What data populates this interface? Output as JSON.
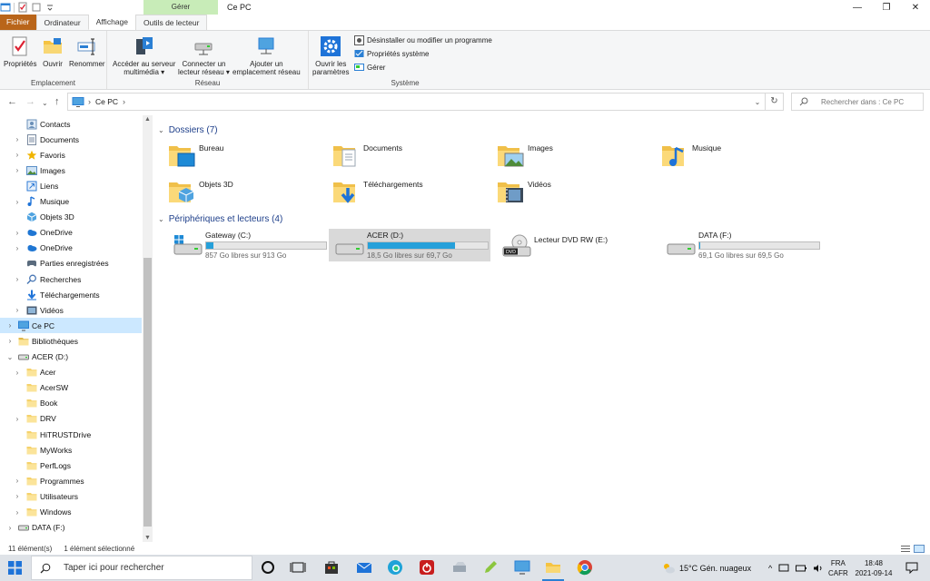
{
  "window": {
    "title": "Ce PC",
    "context_group": "Gérer",
    "controls": {
      "minimize": "—",
      "restore": "❐",
      "close": "✕"
    }
  },
  "tabs": {
    "file": "Fichier",
    "computer": "Ordinateur",
    "view": "Affichage",
    "drive_tools": "Outils de lecteur"
  },
  "ribbon": {
    "emplacement": {
      "label": "Emplacement",
      "properties": "Propriétés",
      "open": "Ouvrir",
      "rename": "Renommer"
    },
    "reseau": {
      "label": "Réseau",
      "media_line1": "Accéder au serveur",
      "media_line2": "multimédia ▾",
      "map_line1": "Connecter un",
      "map_line2": "lecteur réseau ▾",
      "add_line1": "Ajouter un",
      "add_line2": "emplacement réseau"
    },
    "systeme": {
      "label": "Système",
      "settings_line1": "Ouvrir les",
      "settings_line2": "paramètres",
      "uninstall": "Désinstaller ou modifier un programme",
      "sys_props": "Propriétés système",
      "manage": "Gérer"
    }
  },
  "address": {
    "path": "Ce PC",
    "search_placeholder": "Rechercher dans : Ce PC"
  },
  "nav": {
    "items": [
      {
        "label": "Contacts",
        "icon": "contacts-icon",
        "expandable": false,
        "indent": 1,
        "color": "#6a8fb8"
      },
      {
        "label": "Documents",
        "icon": "documents-icon",
        "expandable": true,
        "indent": 1,
        "color": "#7a8aa0"
      },
      {
        "label": "Favoris",
        "icon": "star-icon",
        "expandable": true,
        "indent": 1,
        "color": "#f0b400"
      },
      {
        "label": "Images",
        "icon": "images-icon",
        "expandable": true,
        "indent": 1,
        "color": "#5b8fc7"
      },
      {
        "label": "Liens",
        "icon": "link-icon",
        "expandable": false,
        "indent": 1,
        "color": "#2d7ad6"
      },
      {
        "label": "Musique",
        "icon": "music-icon",
        "expandable": true,
        "indent": 1,
        "color": "#1e73d8"
      },
      {
        "label": "Objets 3D",
        "icon": "objects-3d-icon",
        "expandable": false,
        "indent": 1,
        "color": "#4fa3e0"
      },
      {
        "label": "OneDrive",
        "icon": "onedrive-icon",
        "expandable": true,
        "indent": 1,
        "color": "#1f76d3"
      },
      {
        "label": "OneDrive",
        "icon": "onedrive-icon",
        "expandable": true,
        "indent": 1,
        "color": "#1f76d3"
      },
      {
        "label": "Parties enregistrées",
        "icon": "saved-games-icon",
        "expandable": false,
        "indent": 1,
        "color": "#5a6b7d"
      },
      {
        "label": "Recherches",
        "icon": "search-icon",
        "expandable": true,
        "indent": 1,
        "color": "#4a78b5"
      },
      {
        "label": "Téléchargements",
        "icon": "download-icon",
        "expandable": false,
        "indent": 1,
        "color": "#1e73d8"
      },
      {
        "label": "Vidéos",
        "icon": "videos-icon",
        "expandable": true,
        "indent": 1,
        "color": "#4a5b70"
      },
      {
        "label": "Ce PC",
        "icon": "this-pc-icon",
        "expandable": true,
        "indent": 0,
        "color": "#2a7fd4",
        "selected": true
      },
      {
        "label": "Bibliothèques",
        "icon": "libraries-icon",
        "expandable": true,
        "indent": 0,
        "color": "#e0b94a"
      },
      {
        "label": "ACER (D:)",
        "icon": "drive-icon",
        "expandable": true,
        "expanded": true,
        "indent": 0,
        "color": "#777777"
      },
      {
        "label": "Acer",
        "icon": "folder-icon",
        "expandable": true,
        "indent": 1,
        "color": "#f5d26b"
      },
      {
        "label": "AcerSW",
        "icon": "folder-icon",
        "expandable": false,
        "indent": 1,
        "color": "#f5d26b"
      },
      {
        "label": "Book",
        "icon": "folder-icon",
        "expandable": false,
        "indent": 1,
        "color": "#f5d26b"
      },
      {
        "label": "DRV",
        "icon": "folder-icon",
        "expandable": true,
        "indent": 1,
        "color": "#f5d26b"
      },
      {
        "label": "HiTRUSTDrive",
        "icon": "folder-icon",
        "expandable": false,
        "indent": 1,
        "color": "#f5d26b"
      },
      {
        "label": "MyWorks",
        "icon": "folder-icon",
        "expandable": false,
        "indent": 1,
        "color": "#f5d26b"
      },
      {
        "label": "PerfLogs",
        "icon": "folder-icon",
        "expandable": false,
        "indent": 1,
        "color": "#f5d26b"
      },
      {
        "label": "Programmes",
        "icon": "folder-icon",
        "expandable": true,
        "indent": 1,
        "color": "#f5d26b"
      },
      {
        "label": "Utilisateurs",
        "icon": "folder-icon",
        "expandable": true,
        "indent": 1,
        "color": "#f5d26b"
      },
      {
        "label": "Windows",
        "icon": "folder-icon",
        "expandable": true,
        "indent": 1,
        "color": "#f5d26b"
      },
      {
        "label": "DATA (F:)",
        "icon": "drive-icon",
        "expandable": true,
        "indent": 0,
        "color": "#777777"
      }
    ]
  },
  "content": {
    "folders_header": "Dossiers (7)",
    "folders": [
      {
        "name": "Bureau",
        "icon": "desktop-folder-icon"
      },
      {
        "name": "Documents",
        "icon": "documents-folder-icon"
      },
      {
        "name": "Images",
        "icon": "images-folder-icon"
      },
      {
        "name": "Musique",
        "icon": "music-folder-icon"
      },
      {
        "name": "Objets 3D",
        "icon": "objects-3d-folder-icon"
      },
      {
        "name": "Téléchargements",
        "icon": "downloads-folder-icon"
      },
      {
        "name": "Vidéos",
        "icon": "videos-folder-icon"
      }
    ],
    "devices_header": "Périphériques et lecteurs (4)",
    "drives": [
      {
        "name": "Gateway (C:)",
        "free": "857 Go libres sur 913 Go",
        "used_fraction": 0.06,
        "icon": "windows-drive-icon",
        "selected": false
      },
      {
        "name": "ACER (D:)",
        "free": "18,5 Go libres sur 69,7 Go",
        "used_fraction": 0.73,
        "icon": "drive-icon",
        "selected": true
      },
      {
        "name": "Lecteur DVD RW (E:)",
        "free": "",
        "used_fraction": null,
        "icon": "dvd-drive-icon",
        "selected": false
      },
      {
        "name": "DATA (F:)",
        "free": "69,1 Go libres sur 69,5 Go",
        "used_fraction": 0.006,
        "icon": "drive-icon",
        "selected": false
      }
    ]
  },
  "status": {
    "count": "11 élément(s)",
    "selection": "1 élément sélectionné"
  },
  "taskbar": {
    "search_placeholder": "Taper ici pour rechercher",
    "weather": "15°C  Gén. nuageux",
    "lang_line1": "FRA",
    "lang_line2": "CAFR",
    "time": "18:48",
    "date": "2021-09-14"
  },
  "colors": {
    "file_tab": "#b9651a",
    "context_tab": "#c8ecb8",
    "selection": "#cce8ff",
    "drive_bar": "#26a0da",
    "section_header": "#1e3f8a"
  }
}
